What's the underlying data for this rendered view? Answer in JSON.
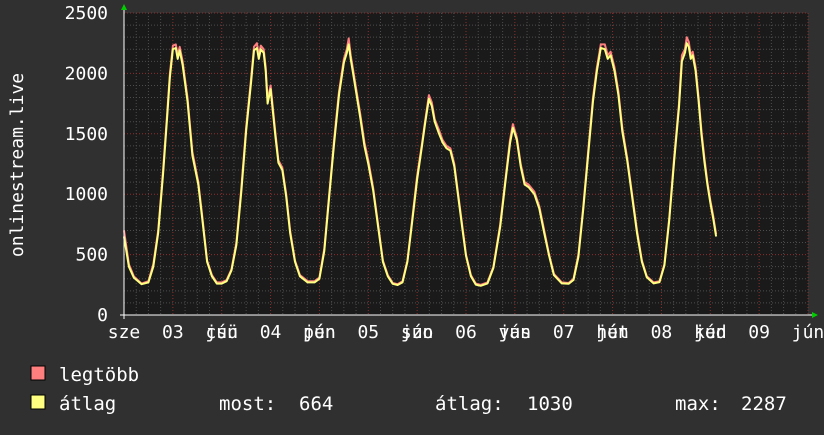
{
  "chart_data": {
    "type": "line",
    "ylabel": "onlinestream.live",
    "ylim": [
      0,
      2500
    ],
    "yticks": [
      0,
      500,
      1000,
      1500,
      2000,
      2500
    ],
    "grid": true,
    "x_tick_labels": [
      {
        "t": 0.0,
        "label": "sze"
      },
      {
        "t": 0.5,
        "label": "03"
      },
      {
        "t": 1.0,
        "label": "jún"
      },
      {
        "t": 1.0,
        "label": "csü"
      },
      {
        "t": 1.5,
        "label": "04"
      },
      {
        "t": 2.0,
        "label": "jún"
      },
      {
        "t": 2.0,
        "label": "pén"
      },
      {
        "t": 2.5,
        "label": "05"
      },
      {
        "t": 3.0,
        "label": "jún"
      },
      {
        "t": 3.0,
        "label": "szo"
      },
      {
        "t": 3.5,
        "label": "06"
      },
      {
        "t": 4.0,
        "label": "jún"
      },
      {
        "t": 4.0,
        "label": "vas"
      },
      {
        "t": 4.5,
        "label": "07"
      },
      {
        "t": 5.0,
        "label": "jún"
      },
      {
        "t": 5.0,
        "label": "hét"
      },
      {
        "t": 5.5,
        "label": "08"
      },
      {
        "t": 6.0,
        "label": "jún"
      },
      {
        "t": 6.0,
        "label": "ked"
      },
      {
        "t": 6.5,
        "label": "09"
      },
      {
        "t": 7.0,
        "label": "jún"
      }
    ],
    "series": [
      {
        "name": "legtöbb",
        "color": "#ff7f7f",
        "values": [
          [
            0.0,
            700
          ],
          [
            0.05,
            420
          ],
          [
            0.1,
            320
          ],
          [
            0.18,
            260
          ],
          [
            0.25,
            280
          ],
          [
            0.3,
            420
          ],
          [
            0.35,
            700
          ],
          [
            0.4,
            1200
          ],
          [
            0.44,
            1650
          ],
          [
            0.47,
            2000
          ],
          [
            0.5,
            2230
          ],
          [
            0.53,
            2240
          ],
          [
            0.55,
            2150
          ],
          [
            0.57,
            2220
          ],
          [
            0.6,
            2100
          ],
          [
            0.65,
            1800
          ],
          [
            0.7,
            1350
          ],
          [
            0.76,
            1100
          ],
          [
            0.8,
            820
          ],
          [
            0.85,
            450
          ],
          [
            0.9,
            330
          ],
          [
            0.95,
            270
          ],
          [
            1.0,
            270
          ],
          [
            1.05,
            290
          ],
          [
            1.1,
            380
          ],
          [
            1.15,
            600
          ],
          [
            1.2,
            1050
          ],
          [
            1.25,
            1550
          ],
          [
            1.3,
            1950
          ],
          [
            1.33,
            2220
          ],
          [
            1.36,
            2250
          ],
          [
            1.38,
            2150
          ],
          [
            1.4,
            2230
          ],
          [
            1.43,
            2200
          ],
          [
            1.45,
            2050
          ],
          [
            1.47,
            1780
          ],
          [
            1.5,
            1900
          ],
          [
            1.55,
            1500
          ],
          [
            1.58,
            1280
          ],
          [
            1.62,
            1220
          ],
          [
            1.66,
            1000
          ],
          [
            1.7,
            700
          ],
          [
            1.75,
            450
          ],
          [
            1.8,
            330
          ],
          [
            1.88,
            280
          ],
          [
            1.95,
            280
          ],
          [
            2.0,
            310
          ],
          [
            2.05,
            550
          ],
          [
            2.1,
            1000
          ],
          [
            2.15,
            1450
          ],
          [
            2.2,
            1850
          ],
          [
            2.25,
            2120
          ],
          [
            2.28,
            2200
          ],
          [
            2.3,
            2290
          ],
          [
            2.32,
            2150
          ],
          [
            2.34,
            2050
          ],
          [
            2.38,
            1850
          ],
          [
            2.42,
            1650
          ],
          [
            2.46,
            1430
          ],
          [
            2.5,
            1280
          ],
          [
            2.55,
            1050
          ],
          [
            2.6,
            750
          ],
          [
            2.65,
            450
          ],
          [
            2.7,
            330
          ],
          [
            2.75,
            265
          ],
          [
            2.8,
            255
          ],
          [
            2.85,
            280
          ],
          [
            2.9,
            450
          ],
          [
            2.95,
            800
          ],
          [
            3.0,
            1150
          ],
          [
            3.05,
            1420
          ],
          [
            3.08,
            1600
          ],
          [
            3.12,
            1820
          ],
          [
            3.15,
            1760
          ],
          [
            3.18,
            1620
          ],
          [
            3.22,
            1540
          ],
          [
            3.26,
            1450
          ],
          [
            3.3,
            1400
          ],
          [
            3.34,
            1380
          ],
          [
            3.38,
            1250
          ],
          [
            3.42,
            1000
          ],
          [
            3.46,
            750
          ],
          [
            3.5,
            500
          ],
          [
            3.55,
            330
          ],
          [
            3.6,
            260
          ],
          [
            3.65,
            250
          ],
          [
            3.72,
            270
          ],
          [
            3.78,
            400
          ],
          [
            3.85,
            750
          ],
          [
            3.9,
            1100
          ],
          [
            3.95,
            1450
          ],
          [
            3.98,
            1580
          ],
          [
            4.02,
            1470
          ],
          [
            4.06,
            1250
          ],
          [
            4.1,
            1100
          ],
          [
            4.14,
            1080
          ],
          [
            4.2,
            1020
          ],
          [
            4.25,
            900
          ],
          [
            4.3,
            700
          ],
          [
            4.35,
            500
          ],
          [
            4.4,
            340
          ],
          [
            4.48,
            270
          ],
          [
            4.55,
            265
          ],
          [
            4.6,
            300
          ],
          [
            4.65,
            500
          ],
          [
            4.7,
            900
          ],
          [
            4.75,
            1350
          ],
          [
            4.8,
            1800
          ],
          [
            4.84,
            2050
          ],
          [
            4.88,
            2240
          ],
          [
            4.92,
            2240
          ],
          [
            4.95,
            2150
          ],
          [
            4.98,
            2180
          ],
          [
            5.02,
            2050
          ],
          [
            5.06,
            1850
          ],
          [
            5.1,
            1550
          ],
          [
            5.15,
            1300
          ],
          [
            5.2,
            1000
          ],
          [
            5.25,
            700
          ],
          [
            5.3,
            450
          ],
          [
            5.35,
            320
          ],
          [
            5.42,
            270
          ],
          [
            5.48,
            280
          ],
          [
            5.53,
            420
          ],
          [
            5.58,
            800
          ],
          [
            5.63,
            1300
          ],
          [
            5.68,
            1750
          ],
          [
            5.71,
            2150
          ],
          [
            5.74,
            2200
          ],
          [
            5.76,
            2300
          ],
          [
            5.78,
            2260
          ],
          [
            5.8,
            2150
          ],
          [
            5.82,
            2180
          ],
          [
            5.85,
            2050
          ],
          [
            5.88,
            1800
          ],
          [
            5.91,
            1520
          ],
          [
            5.94,
            1300
          ],
          [
            5.97,
            1100
          ],
          [
            6.0,
            950
          ],
          [
            6.03,
            820
          ],
          [
            6.06,
            670
          ]
        ]
      },
      {
        "name": "átlag",
        "color": "#ffff80",
        "values": [
          [
            0.0,
            650
          ],
          [
            0.05,
            400
          ],
          [
            0.1,
            310
          ],
          [
            0.18,
            255
          ],
          [
            0.25,
            270
          ],
          [
            0.3,
            400
          ],
          [
            0.35,
            680
          ],
          [
            0.4,
            1170
          ],
          [
            0.44,
            1620
          ],
          [
            0.47,
            1970
          ],
          [
            0.5,
            2200
          ],
          [
            0.53,
            2210
          ],
          [
            0.55,
            2120
          ],
          [
            0.57,
            2190
          ],
          [
            0.6,
            2070
          ],
          [
            0.65,
            1770
          ],
          [
            0.7,
            1320
          ],
          [
            0.76,
            1080
          ],
          [
            0.8,
            800
          ],
          [
            0.85,
            440
          ],
          [
            0.9,
            320
          ],
          [
            0.95,
            260
          ],
          [
            1.0,
            260
          ],
          [
            1.05,
            280
          ],
          [
            1.1,
            370
          ],
          [
            1.15,
            580
          ],
          [
            1.2,
            1020
          ],
          [
            1.25,
            1520
          ],
          [
            1.3,
            1920
          ],
          [
            1.33,
            2190
          ],
          [
            1.36,
            2210
          ],
          [
            1.38,
            2120
          ],
          [
            1.4,
            2200
          ],
          [
            1.43,
            2170
          ],
          [
            1.45,
            2020
          ],
          [
            1.47,
            1750
          ],
          [
            1.5,
            1870
          ],
          [
            1.55,
            1470
          ],
          [
            1.58,
            1260
          ],
          [
            1.62,
            1200
          ],
          [
            1.66,
            980
          ],
          [
            1.7,
            680
          ],
          [
            1.75,
            440
          ],
          [
            1.8,
            320
          ],
          [
            1.88,
            270
          ],
          [
            1.95,
            270
          ],
          [
            2.0,
            300
          ],
          [
            2.05,
            530
          ],
          [
            2.1,
            980
          ],
          [
            2.15,
            1420
          ],
          [
            2.2,
            1820
          ],
          [
            2.25,
            2090
          ],
          [
            2.28,
            2170
          ],
          [
            2.3,
            2240
          ],
          [
            2.32,
            2120
          ],
          [
            2.34,
            2020
          ],
          [
            2.38,
            1820
          ],
          [
            2.42,
            1620
          ],
          [
            2.46,
            1400
          ],
          [
            2.5,
            1250
          ],
          [
            2.55,
            1030
          ],
          [
            2.6,
            730
          ],
          [
            2.65,
            440
          ],
          [
            2.7,
            320
          ],
          [
            2.75,
            258
          ],
          [
            2.8,
            248
          ],
          [
            2.85,
            270
          ],
          [
            2.9,
            440
          ],
          [
            2.95,
            780
          ],
          [
            3.0,
            1120
          ],
          [
            3.05,
            1400
          ],
          [
            3.08,
            1580
          ],
          [
            3.12,
            1790
          ],
          [
            3.15,
            1730
          ],
          [
            3.18,
            1600
          ],
          [
            3.22,
            1510
          ],
          [
            3.26,
            1430
          ],
          [
            3.3,
            1380
          ],
          [
            3.34,
            1360
          ],
          [
            3.38,
            1230
          ],
          [
            3.42,
            980
          ],
          [
            3.46,
            730
          ],
          [
            3.5,
            490
          ],
          [
            3.55,
            320
          ],
          [
            3.6,
            252
          ],
          [
            3.65,
            242
          ],
          [
            3.72,
            262
          ],
          [
            3.78,
            390
          ],
          [
            3.85,
            730
          ],
          [
            3.9,
            1080
          ],
          [
            3.95,
            1420
          ],
          [
            3.98,
            1550
          ],
          [
            4.02,
            1450
          ],
          [
            4.06,
            1230
          ],
          [
            4.1,
            1080
          ],
          [
            4.14,
            1060
          ],
          [
            4.2,
            1000
          ],
          [
            4.25,
            880
          ],
          [
            4.3,
            680
          ],
          [
            4.35,
            490
          ],
          [
            4.4,
            330
          ],
          [
            4.48,
            262
          ],
          [
            4.55,
            258
          ],
          [
            4.6,
            290
          ],
          [
            4.65,
            480
          ],
          [
            4.7,
            880
          ],
          [
            4.75,
            1320
          ],
          [
            4.8,
            1770
          ],
          [
            4.84,
            2020
          ],
          [
            4.88,
            2210
          ],
          [
            4.92,
            2200
          ],
          [
            4.95,
            2120
          ],
          [
            4.98,
            2150
          ],
          [
            5.02,
            2020
          ],
          [
            5.06,
            1820
          ],
          [
            5.1,
            1520
          ],
          [
            5.15,
            1280
          ],
          [
            5.2,
            980
          ],
          [
            5.25,
            680
          ],
          [
            5.3,
            440
          ],
          [
            5.35,
            312
          ],
          [
            5.42,
            262
          ],
          [
            5.48,
            272
          ],
          [
            5.53,
            410
          ],
          [
            5.58,
            780
          ],
          [
            5.63,
            1270
          ],
          [
            5.68,
            1720
          ],
          [
            5.71,
            2100
          ],
          [
            5.74,
            2170
          ],
          [
            5.76,
            2250
          ],
          [
            5.78,
            2220
          ],
          [
            5.8,
            2120
          ],
          [
            5.82,
            2150
          ],
          [
            5.85,
            2020
          ],
          [
            5.88,
            1770
          ],
          [
            5.91,
            1490
          ],
          [
            5.94,
            1270
          ],
          [
            5.97,
            1080
          ],
          [
            6.0,
            930
          ],
          [
            6.03,
            800
          ],
          [
            6.06,
            650
          ]
        ]
      }
    ],
    "x_range": [
      0,
      7.0
    ]
  },
  "legend": {
    "items": [
      {
        "label": "legtöbb",
        "color": "#ff7f7f"
      },
      {
        "label": "átlag",
        "color": "#ffff80"
      }
    ],
    "stats": [
      {
        "label": "most:",
        "value": "664"
      },
      {
        "label": "átlag:",
        "value": "1030"
      },
      {
        "label": "max:",
        "value": "2287"
      }
    ]
  },
  "colors": {
    "background": "#303030",
    "plot_background": "#1a1a1a",
    "grid": "#4d4d4d",
    "grid_major": "#8b2f2f",
    "axis": "#ffffff",
    "arrow": "#00cc00"
  }
}
